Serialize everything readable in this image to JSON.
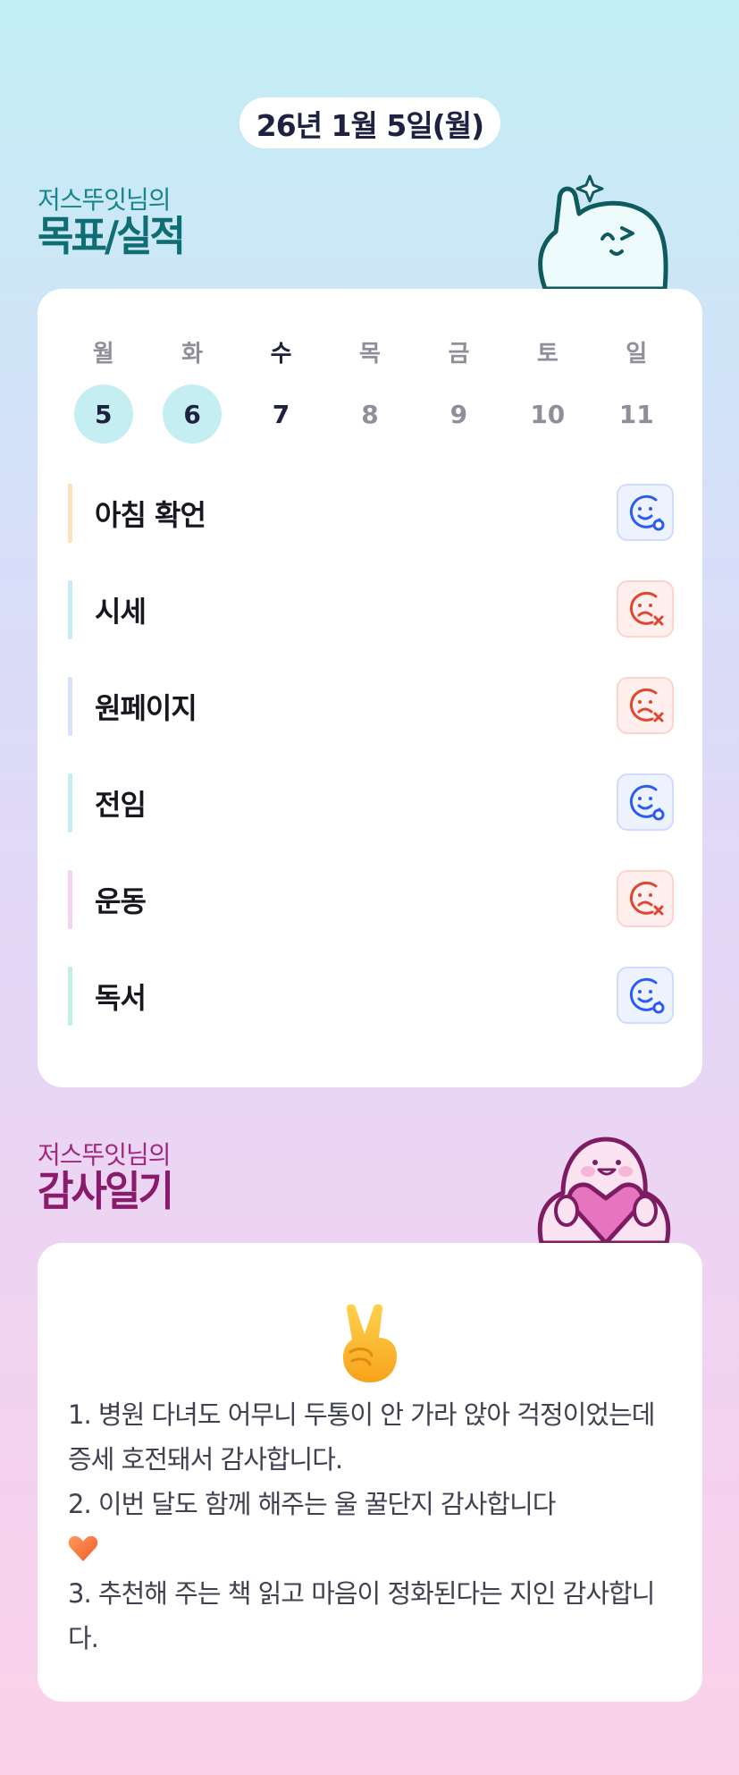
{
  "date_display": "26년 1월 5일(월)",
  "goal_section": {
    "subtitle": "저스뚜잇님의",
    "title": "목표/실적"
  },
  "week": {
    "days": [
      {
        "weekday": "월",
        "date": "5",
        "state": "done"
      },
      {
        "weekday": "화",
        "date": "6",
        "state": "done"
      },
      {
        "weekday": "수",
        "date": "7",
        "state": "today"
      },
      {
        "weekday": "목",
        "date": "8",
        "state": "future"
      },
      {
        "weekday": "금",
        "date": "9",
        "state": "future"
      },
      {
        "weekday": "토",
        "date": "10",
        "state": "future"
      },
      {
        "weekday": "일",
        "date": "11",
        "state": "future"
      }
    ]
  },
  "goals": [
    {
      "label": "아침 확언",
      "status": "success",
      "bar_color": "#fde2bf",
      "icon": "smile-check-icon"
    },
    {
      "label": "시세",
      "status": "fail",
      "bar_color": "#c6edf2",
      "icon": "sad-x-icon"
    },
    {
      "label": "원페이지",
      "status": "fail",
      "bar_color": "#d8e3fb",
      "icon": "sad-x-icon"
    },
    {
      "label": "전임",
      "status": "success",
      "bar_color": "#c6edf2",
      "icon": "smile-check-icon"
    },
    {
      "label": "운동",
      "status": "fail",
      "bar_color": "#f6d3ee",
      "icon": "sad-x-icon"
    },
    {
      "label": "독서",
      "status": "success",
      "bar_color": "#bff0e0",
      "icon": "smile-check-icon"
    }
  ],
  "thanks_section": {
    "subtitle": "저스뚜잇님의",
    "title": "감사일기"
  },
  "diary": {
    "emoji": "victory-hand-icon",
    "lines": [
      "1. 병원 다녀도 어무니 두통이 안 가라 앉아 걱정이었는데 증세 호전돼서 감사합니다.",
      "2. 이번 달도 함께 해주는 울 꿀단지 감사합니다",
      "3. 추천해 주는 책 읽고 마음이 정화된다는 지인 감사합니다."
    ],
    "heart_icon": "orange-heart-icon"
  },
  "colors": {
    "success_icon": "#2a5bf2",
    "fail_icon": "#e0462f",
    "done_day_bg": "#c4eef2",
    "goal_title": "#0f6e73",
    "thanks_title": "#8a1b6c"
  }
}
